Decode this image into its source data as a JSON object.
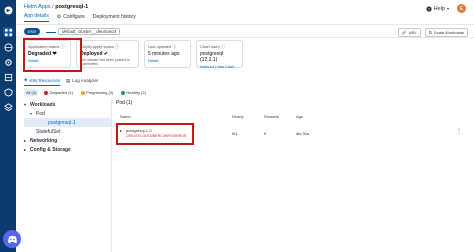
{
  "breadcrumb": {
    "parent": "Helm Apps",
    "separator": "/",
    "current": "postgresql-1"
  },
  "topright": {
    "help_label": "Help",
    "avatar_initial": "E"
  },
  "tabs": [
    {
      "label": "App details"
    },
    {
      "label": "Configure"
    },
    {
      "label": "Deployment history"
    }
  ],
  "environment": {
    "badge": "ENV",
    "name": "default_cluster__devtroncd"
  },
  "actions": {
    "urls_label": "URL",
    "scale_label": "Scale Workloads"
  },
  "cards": {
    "app_status": {
      "label": "Application status",
      "value": "Degraded",
      "link": "Details"
    },
    "config_status": {
      "label": "Config apply status",
      "value": "Deployed",
      "sub": "The release has been pushed to Kubernetes"
    },
    "last_updated": {
      "label": "Last updated",
      "value": "5 minutes ago",
      "link": "Details"
    },
    "chart_used": {
      "label": "Chart used",
      "value": "postgresql (12.2.1)",
      "link1": "Notes.txt",
      "link2": "View Chart"
    }
  },
  "subtabs": [
    {
      "label": "K8s Resources"
    },
    {
      "label": "Log Analyzer"
    }
  ],
  "filters": [
    {
      "label": "All (3)"
    },
    {
      "label": "Degraded (1)",
      "color": "#c2282f"
    },
    {
      "label": "Progressing (0)",
      "color": "#f5a623"
    },
    {
      "label": "Healthy (2)",
      "color": "#1f9c5a"
    }
  ],
  "tree": {
    "workloads": "Workloads",
    "pod": "Pod",
    "pod_item": "postgresql-1",
    "statefulset": "StatefulSet",
    "networking": "Networking",
    "config_storage": "Config & Storage"
  },
  "content": {
    "title": "Pod (1)",
    "headers": {
      "name": "Name",
      "ready": "Ready",
      "restarts": "Restarts",
      "age": "Age"
    },
    "row": {
      "name": "postgresql-1-0",
      "hash": "CREATECONTAINERCONFIGERROR",
      "ready": "0/1",
      "restarts": "0",
      "age": "4m 31s"
    }
  },
  "colors": {
    "sidebar": "#0b3b6f",
    "accent": "#0066cc",
    "degraded": "#c2282f",
    "healthy": "#1f9c5a",
    "highlight_box": "#c01818"
  }
}
